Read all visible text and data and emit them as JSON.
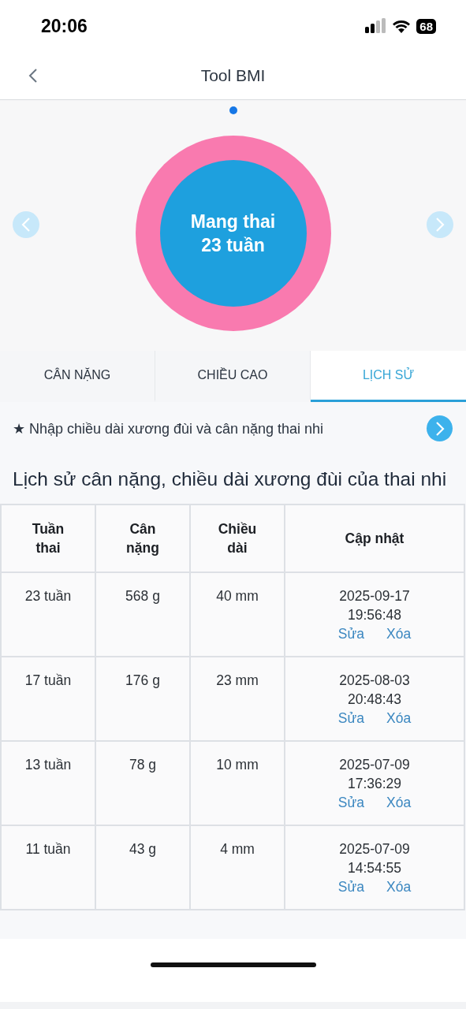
{
  "status_bar": {
    "time": "20:06",
    "battery": "68"
  },
  "nav": {
    "title": "Tool BMI"
  },
  "carousel": {
    "pages": [
      {
        "selected": true
      }
    ],
    "ring_lines": [
      "Mang thai",
      "23 tuần"
    ]
  },
  "tabs": [
    {
      "label": "CÂN NẶNG",
      "selected": false
    },
    {
      "label": "CHIỀU CAO",
      "selected": false
    },
    {
      "label": "LỊCH SỬ",
      "selected": true
    }
  ],
  "hint": {
    "star": "★",
    "text": "Nhập chiều dài xương đùi và cân nặng thai nhi"
  },
  "heading": "Lịch sử cân nặng, chiều dài xương đùi của thai nhi",
  "table": {
    "columns": [
      "Tuần thai",
      "Cân nặng",
      "Chiều dài",
      "Cập nhật"
    ],
    "rows": [
      {
        "week": "23 tuần",
        "weight": "568 g",
        "length": "40 mm",
        "date": "2025-09-17",
        "time": "19:56:48",
        "edit": "Sửa",
        "delete": "Xóa"
      },
      {
        "week": "17 tuần",
        "weight": "176 g",
        "length": "23 mm",
        "date": "2025-08-03",
        "time": "20:48:43",
        "edit": "Sửa",
        "delete": "Xóa"
      },
      {
        "week": "13 tuần",
        "weight": "78 g",
        "length": "10 mm",
        "date": "2025-07-09",
        "time": "17:36:29",
        "edit": "Sửa",
        "delete": "Xóa"
      },
      {
        "week": "11 tuần",
        "weight": "43 g",
        "length": "4 mm",
        "date": "2025-07-09",
        "time": "14:54:55",
        "edit": "Sửa",
        "delete": "Xóa"
      }
    ]
  }
}
